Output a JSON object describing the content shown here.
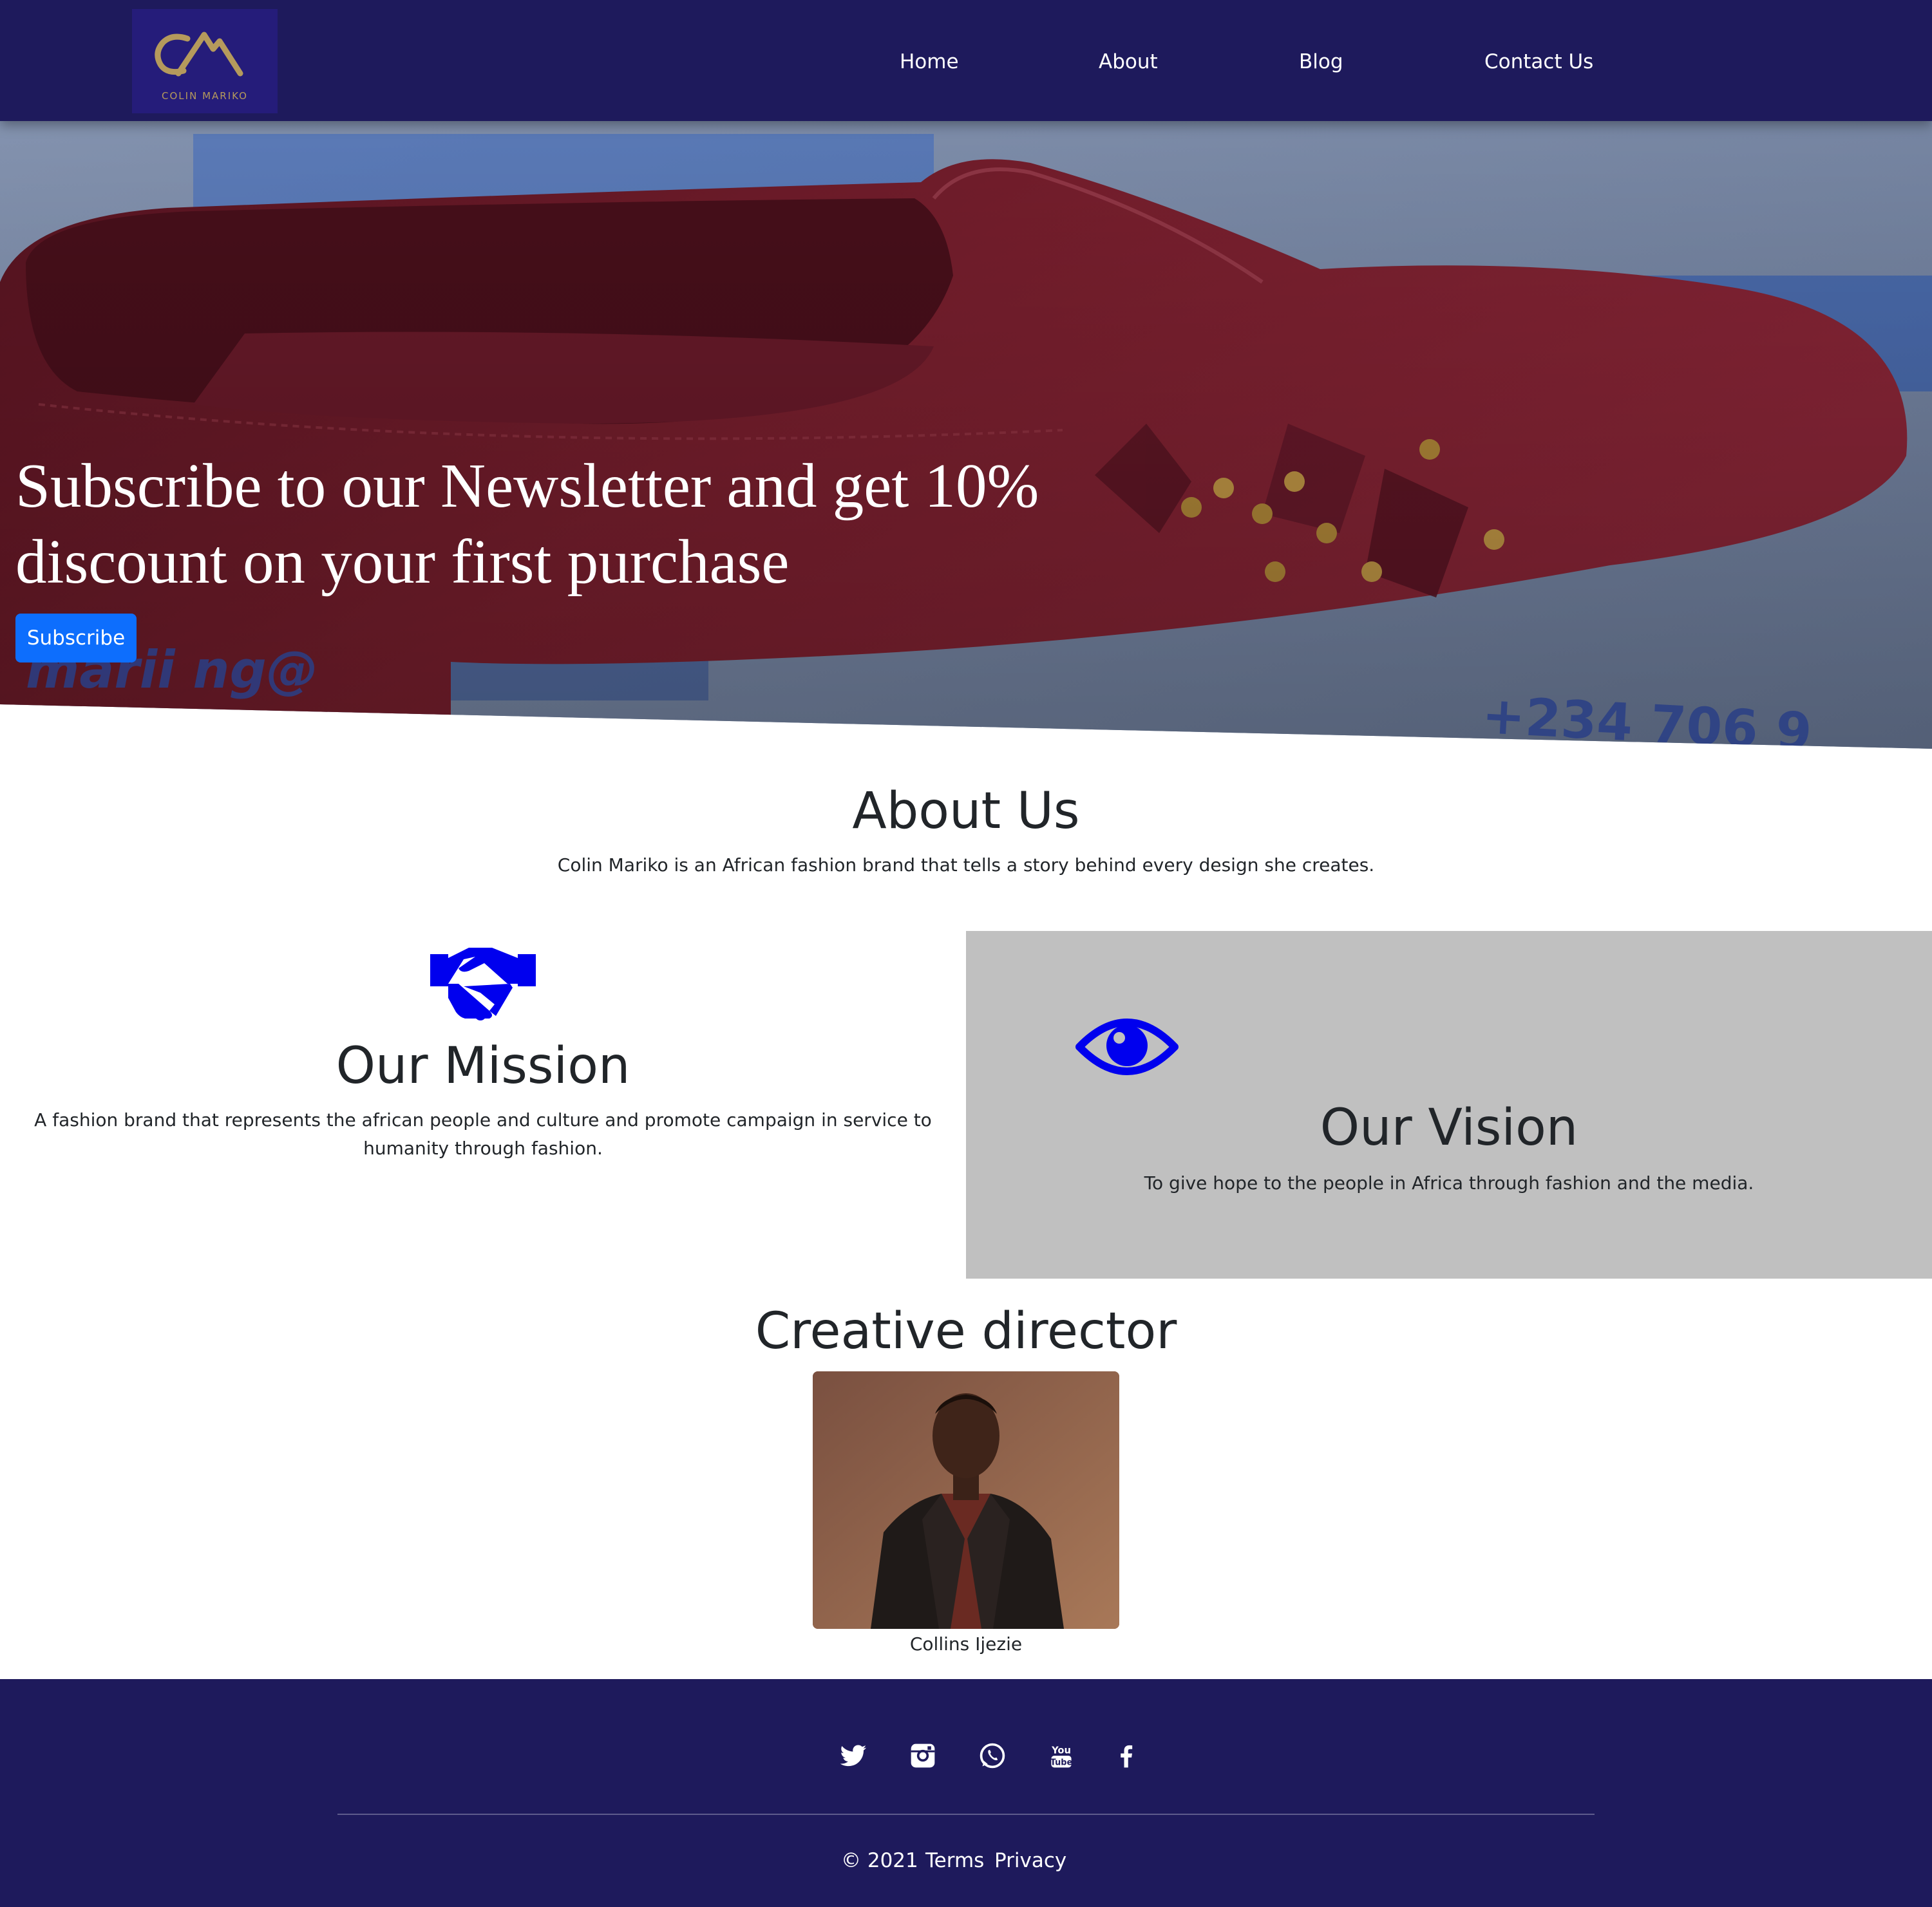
{
  "brand": {
    "logo_initials": "CA",
    "logo_text": "COLIN MARIKO",
    "logo_color": "#b59a5c",
    "nav_background": "#1e1a5c"
  },
  "nav": {
    "home": "Home",
    "about": "About",
    "blog": "Blog",
    "contact": "Contact Us"
  },
  "hero": {
    "title": "Subscribe to our Newsletter and get 10% discount on your first purchase",
    "button_label": "Subscribe",
    "button_color": "#0d6efd",
    "background_fragments": {
      "email": "marii        ng@",
      "phone": "+234 706 9"
    }
  },
  "about": {
    "title": "About Us",
    "text": "Colin Mariko is an African fashion brand that tells a story behind every design she creates."
  },
  "mission": {
    "icon": "handshake-icon",
    "title": "Our Mission",
    "text": "A fashion brand that represents the african people and culture and promote campaign in service to humanity through fashion."
  },
  "vision": {
    "icon": "eye-icon",
    "title": "Our Vision",
    "text": "To give hope to the people in Africa through fashion and the media.",
    "background": "#c0c0c0"
  },
  "icon_color": "#0000ee",
  "director": {
    "title": "Creative director",
    "name": "Collins Ijezie"
  },
  "footer": {
    "social_icons": [
      "twitter-icon",
      "instagram-icon",
      "whatsapp-icon",
      "youtube-icon",
      "facebook-icon"
    ],
    "copyright": "© 2021",
    "terms": "Terms",
    "privacy": "Privacy"
  }
}
